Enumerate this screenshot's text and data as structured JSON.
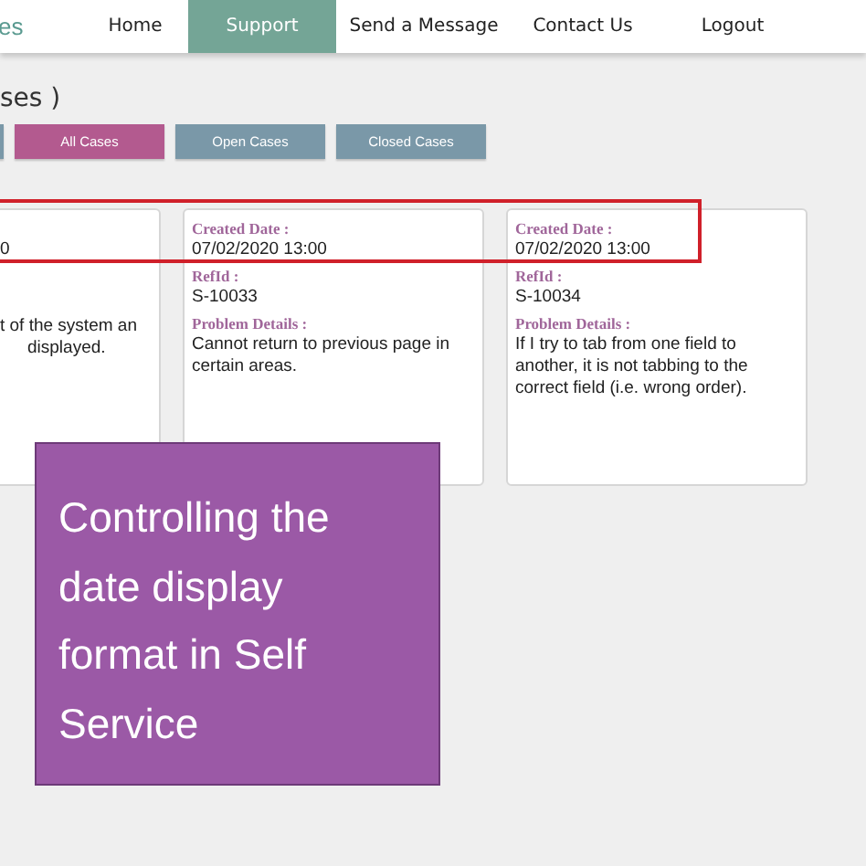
{
  "brand": "es",
  "nav": [
    {
      "label": "Home",
      "selected": false
    },
    {
      "label": "Support",
      "selected": true
    },
    {
      "label": "Send a Message",
      "selected": false
    },
    {
      "label": "Contact Us",
      "selected": false
    },
    {
      "label": "Logout",
      "selected": false
    }
  ],
  "page_title": "ses )",
  "filters": [
    {
      "selected": false
    },
    {
      "label": "All Cases",
      "selected": true
    },
    {
      "label": "Open Cases",
      "selected": false
    },
    {
      "label": "Closed Cases",
      "selected": false
    }
  ],
  "cards": [
    {
      "kind": "partial",
      "date": "0",
      "details": [
        "t of the system an",
        "displayed."
      ]
    },
    {
      "kind": "full",
      "date_label": "Created Date  :",
      "date": "07/02/2020 13:00",
      "ref_label": "RefId :",
      "ref": "S-10033",
      "details_label": "Problem Details :",
      "details": [
        "Cannot return to previous page in",
        "certain areas."
      ]
    },
    {
      "kind": "full",
      "date_label": "Created Date  :",
      "date": "07/02/2020 13:00",
      "ref_label": "RefId :",
      "ref": "S-10034",
      "details_label": "Problem Details :",
      "details": [
        "If I try to tab from one field to",
        "another, it is not tabbing to the",
        "correct field (i.e. wrong order)."
      ]
    }
  ],
  "callout": {
    "lines": [
      "Controlling the",
      "date display",
      "format in Self",
      "Service"
    ]
  }
}
